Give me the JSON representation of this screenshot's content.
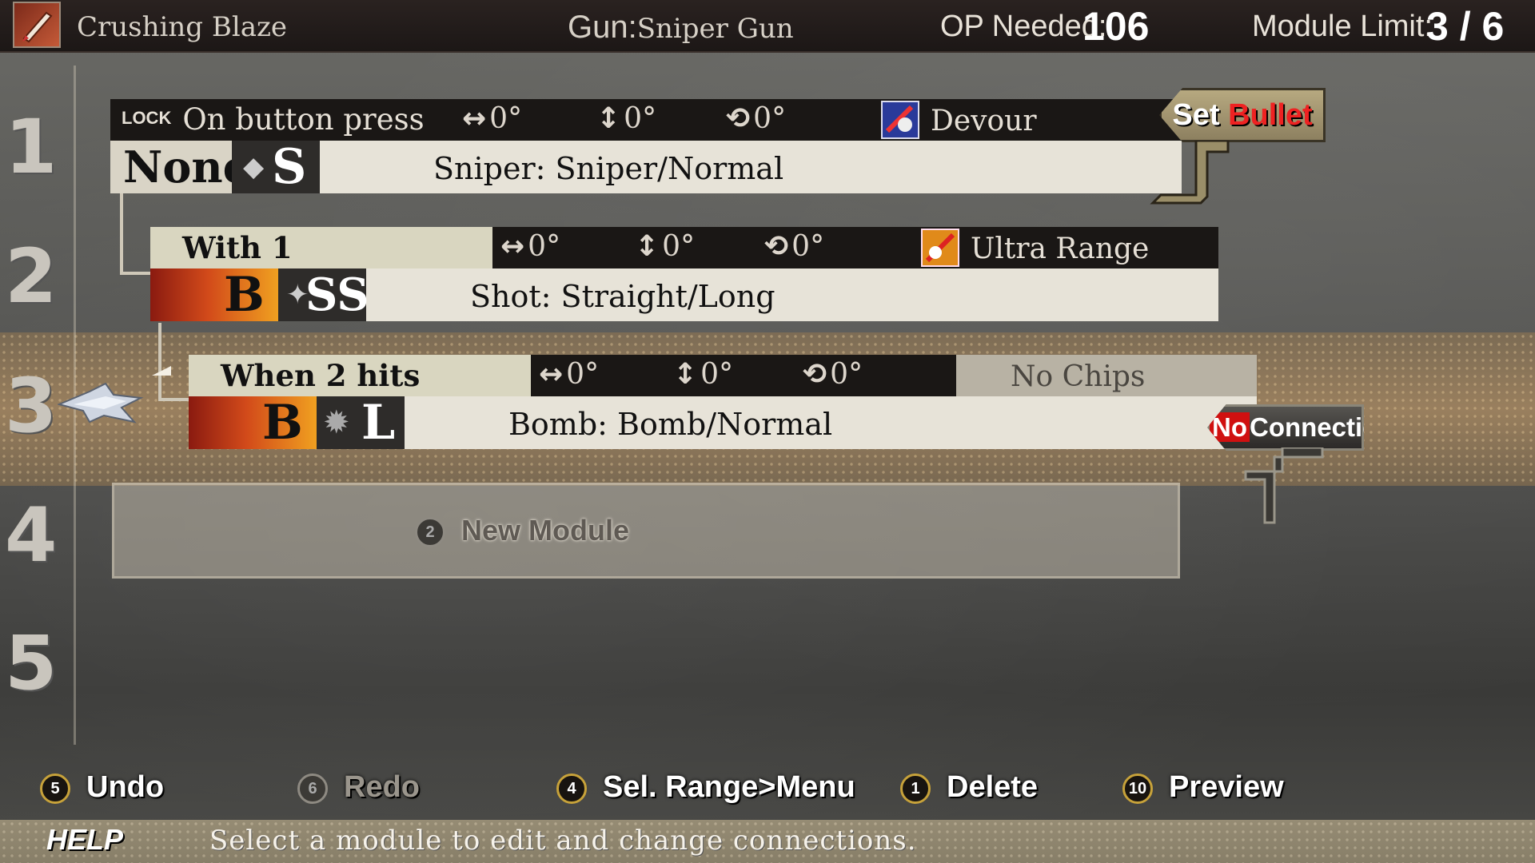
{
  "header": {
    "bullet_name": "Crushing Blaze",
    "gun_label": "Gun:",
    "gun_value": "Sniper Gun",
    "op_label": "OP Needed:",
    "op_value": "106",
    "module_label": "Module  Limit:",
    "module_value": "3 / 6",
    "weapon_icon": "sniper-bullet-icon"
  },
  "rows": [
    "1",
    "2",
    "3",
    "4",
    "5"
  ],
  "modules": [
    {
      "lock": "LOCK",
      "trigger": "On button press",
      "angles": [
        {
          "symbol": "↔",
          "value": "0°"
        },
        {
          "symbol": "↕",
          "value": "0°"
        },
        {
          "symbol": "⟲",
          "value": "0°"
        }
      ],
      "chip": "Devour",
      "chip_icon": "devour-chip-icon",
      "element": "None",
      "size": "S",
      "bullet_type": "Sniper: Sniper/Normal"
    },
    {
      "trigger": "With  1",
      "angles": [
        {
          "symbol": "↔",
          "value": "0°"
        },
        {
          "symbol": "↕",
          "value": "0°"
        },
        {
          "symbol": "⟲",
          "value": "0°"
        }
      ],
      "chip": "Ultra Range",
      "chip_icon": "ultra-range-chip-icon",
      "element": "B",
      "size": "SS",
      "bullet_type": "Shot: Straight/Long"
    },
    {
      "trigger": "When  2  hits",
      "angles": [
        {
          "symbol": "↔",
          "value": "0°"
        },
        {
          "symbol": "↕",
          "value": "0°"
        },
        {
          "symbol": "⟲",
          "value": "0°"
        }
      ],
      "chip": "No Chips",
      "element": "B",
      "size": "L",
      "bullet_type": "Bomb: Bomb/Normal"
    }
  ],
  "set_bullet": {
    "part1": "Set ",
    "part2": "Bullet"
  },
  "no_connection": {
    "part1": "No",
    "part2": "Connection"
  },
  "new_module": {
    "button": "2",
    "label": "New Module"
  },
  "controls": [
    {
      "button": "5",
      "label": "Undo"
    },
    {
      "button": "6",
      "label": "Redo"
    },
    {
      "button": "4",
      "label": "Sel. Range>Menu"
    },
    {
      "button": "1",
      "label": "Delete"
    },
    {
      "button": "10",
      "label": "Preview"
    }
  ],
  "help": {
    "label": "HELP",
    "text": "Select a module to edit and change connections."
  },
  "colors": {
    "accent_red": "#dd2222",
    "button_ring": "#c7a23a",
    "selection_band": "#b89660"
  }
}
